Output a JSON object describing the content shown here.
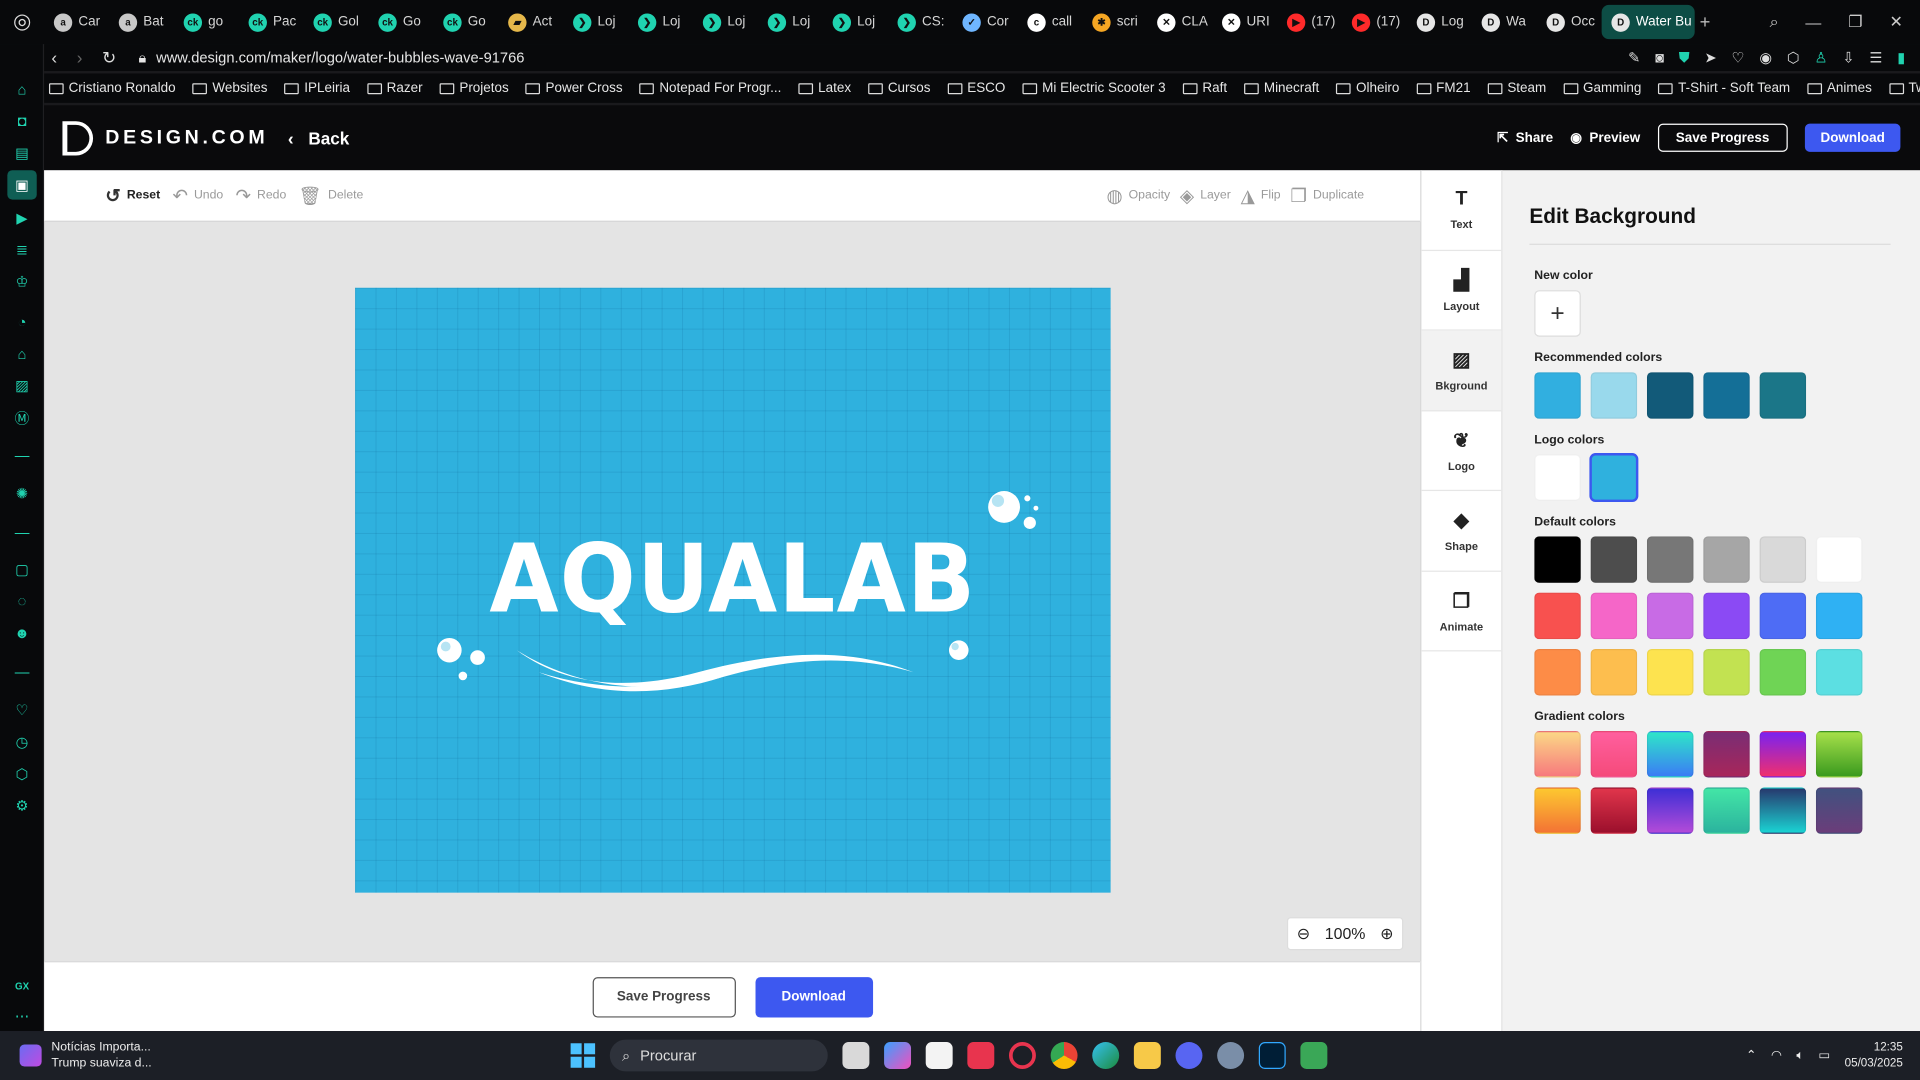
{
  "browser": {
    "tabs": [
      {
        "label": "Car",
        "color": "#c8c8c8",
        "glyph": "a"
      },
      {
        "label": "Bat",
        "color": "#c8c8c8",
        "glyph": "a"
      },
      {
        "label": "go",
        "color": "#20d3b0",
        "glyph": "ck"
      },
      {
        "label": "Pac",
        "color": "#20d3b0",
        "glyph": "ck"
      },
      {
        "label": "Gol",
        "color": "#20d3b0",
        "glyph": "ck"
      },
      {
        "label": "Go",
        "color": "#20d3b0",
        "glyph": "ck"
      },
      {
        "label": "Go",
        "color": "#20d3b0",
        "glyph": "ck"
      },
      {
        "label": "Act",
        "color": "#e6b84a",
        "glyph": "▰"
      },
      {
        "label": "Loj",
        "color": "#20d3b0",
        "glyph": "❯"
      },
      {
        "label": "Loj",
        "color": "#20d3b0",
        "glyph": "❯"
      },
      {
        "label": "Loj",
        "color": "#20d3b0",
        "glyph": "❯"
      },
      {
        "label": "Loj",
        "color": "#20d3b0",
        "glyph": "❯"
      },
      {
        "label": "Loj",
        "color": "#20d3b0",
        "glyph": "❯"
      },
      {
        "label": "CS:",
        "color": "#20d3b0",
        "glyph": "❯"
      },
      {
        "label": "Cor",
        "color": "#6fb6ff",
        "glyph": "✓"
      },
      {
        "label": "call",
        "color": "#ffffff",
        "glyph": "c"
      },
      {
        "label": "scri",
        "color": "#f5a623",
        "glyph": "✱"
      },
      {
        "label": "CLA",
        "color": "#ffffff",
        "glyph": "✕"
      },
      {
        "label": "URI",
        "color": "#ffffff",
        "glyph": "✕"
      },
      {
        "label": "(17)",
        "color": "#ff2a2a",
        "glyph": "▶"
      },
      {
        "label": "(17)",
        "color": "#ff2a2a",
        "glyph": "▶"
      },
      {
        "label": "Log",
        "color": "#e6e6e6",
        "glyph": "D"
      },
      {
        "label": "Wa",
        "color": "#e6e6e6",
        "glyph": "D"
      },
      {
        "label": "Occ",
        "color": "#e6e6e6",
        "glyph": "D"
      }
    ],
    "active_tab": "Water Bu",
    "url": "www.design.com/maker/logo/water-bubbles-wave-91766",
    "bookmarks": [
      "Cristiano Ronaldo",
      "Websites",
      "IPLeiria",
      "Razer",
      "Projetos",
      "Power Cross",
      "Notepad For Progr...",
      "Latex",
      "Cursos",
      "ESCO",
      "Mi Electric Scooter 3",
      "Raft",
      "Minecraft",
      "Olheiro",
      "FM21",
      "Steam",
      "Gamming",
      "T-Shirt - Soft Team",
      "Animes",
      "Twitch"
    ]
  },
  "app": {
    "brand": "DESIGN.COM",
    "back": "Back",
    "share": "Share",
    "preview": "Preview",
    "save_progress": "Save Progress",
    "download": "Download"
  },
  "toolbar": {
    "reset": "Reset",
    "undo": "Undo",
    "redo": "Redo",
    "delete": "Delete",
    "opacity": "Opacity",
    "layer": "Layer",
    "flip": "Flip",
    "duplicate": "Duplicate"
  },
  "canvas": {
    "logo_text": "AQUALAB",
    "background": "#2fb1de",
    "zoom": "100%"
  },
  "rail": [
    {
      "label": "Text",
      "icon": "text-icon",
      "glyph": "T"
    },
    {
      "label": "Layout",
      "icon": "layout-icon",
      "glyph": "▟"
    },
    {
      "label": "Bkground",
      "icon": "background-icon",
      "glyph": "▨"
    },
    {
      "label": "Logo",
      "icon": "logo-icon",
      "glyph": "❦"
    },
    {
      "label": "Shape",
      "icon": "shape-icon",
      "glyph": "◆"
    },
    {
      "label": "Animate",
      "icon": "animate-icon",
      "glyph": "❐"
    }
  ],
  "panel": {
    "title": "Edit Background",
    "new_color": "New color",
    "recommended_label": "Recommended colors",
    "recommended": [
      "#31afe0",
      "#99d9ec",
      "#125a79",
      "#146f97",
      "#1b7688"
    ],
    "logo_label": "Logo colors",
    "logo_colors": [
      "#ffffff",
      "#2fb1de"
    ],
    "default_label": "Default colors",
    "default_colors": [
      [
        "#000000",
        "#4d4d4d",
        "#777777",
        "#a6a6a6",
        "#d9d9d9",
        "#ffffff"
      ],
      [
        "#f8514f",
        "#f566c8",
        "#c86be5",
        "#8b4af4",
        "#4e6cf5",
        "#2fb1f3"
      ],
      [
        "#fd8c47",
        "#fdbe4e",
        "#fde34f",
        "#c2e251",
        "#6fd455",
        "#5cdfe2"
      ]
    ],
    "gradient_label": "Gradient colors",
    "gradients": [
      [
        "linear-gradient(180deg,#fbd786,#f7797d)",
        "linear-gradient(180deg,#ff5f9e,#f54a7a)",
        "linear-gradient(180deg,#2ee6c8,#3b7cf5)",
        "linear-gradient(180deg,#7a2d74,#a8265a)",
        "linear-gradient(180deg,#7a22f0,#f02f6e)",
        "linear-gradient(180deg,#a6e04a,#3a9a1e)"
      ],
      [
        "linear-gradient(180deg,#fdc830,#f37335)",
        "linear-gradient(180deg,#e0354b,#9b0f2c)",
        "linear-gradient(180deg,#3d2fd6,#b34bd8)",
        "linear-gradient(180deg,#43e5a6,#2bb39e)",
        "linear-gradient(180deg,#27396e,#1ad3d3)",
        "linear-gradient(180deg,#41517f,#6b3d7a)"
      ]
    ]
  },
  "taskbar": {
    "news_title": "Notícias Importa...",
    "news_sub": "Trump suaviza d...",
    "search": "Procurar",
    "time": "12:35",
    "date": "05/03/2025"
  }
}
